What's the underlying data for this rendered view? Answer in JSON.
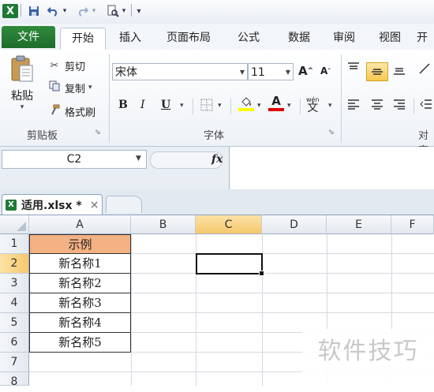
{
  "quick_access": {
    "undo_arrow": "▾",
    "redo_arrow": "▾",
    "customize": "▾"
  },
  "tabs": [
    {
      "label": "文件"
    },
    {
      "label": "开始"
    },
    {
      "label": "插入"
    },
    {
      "label": "页面布局"
    },
    {
      "label": "公式"
    },
    {
      "label": "数据"
    },
    {
      "label": "审阅"
    },
    {
      "label": "视图"
    },
    {
      "label": "开"
    }
  ],
  "ribbon": {
    "clipboard": {
      "paste_label": "粘贴",
      "cut_label": "剪切",
      "copy_label": "复制",
      "format_painter_label": "格式刷",
      "group_label": "剪贴板"
    },
    "font": {
      "font_name": "宋体",
      "font_size": "11",
      "group_label": "字体",
      "bold": "B",
      "italic": "I",
      "underline": "U",
      "grow": "A",
      "shrink": "A",
      "color_a": "A",
      "phonetic": "wén",
      "phonetic_char": "文"
    },
    "alignment": {
      "group_label": "对齐"
    },
    "colors": {
      "fill_yellow": "#ffff00",
      "font_red": "#e00000",
      "accent_green": "#1f6d2c"
    }
  },
  "formula_bar": {
    "name_box": "C2",
    "fx": "fx"
  },
  "workbook": {
    "tab_name": "适用.xlsx *",
    "close": "×"
  },
  "grid": {
    "columns": [
      "A",
      "B",
      "C",
      "D",
      "E",
      "F"
    ],
    "rows": [
      "1",
      "2",
      "3",
      "4",
      "5",
      "6",
      "7",
      "8"
    ],
    "active_column": "C",
    "active_row": "2",
    "column_a_values": [
      "示例",
      "新名称1",
      "新名称2",
      "新名称3",
      "新名称4",
      "新名称5"
    ],
    "header_fill": "#f4b183"
  },
  "watermark": "软件技巧"
}
